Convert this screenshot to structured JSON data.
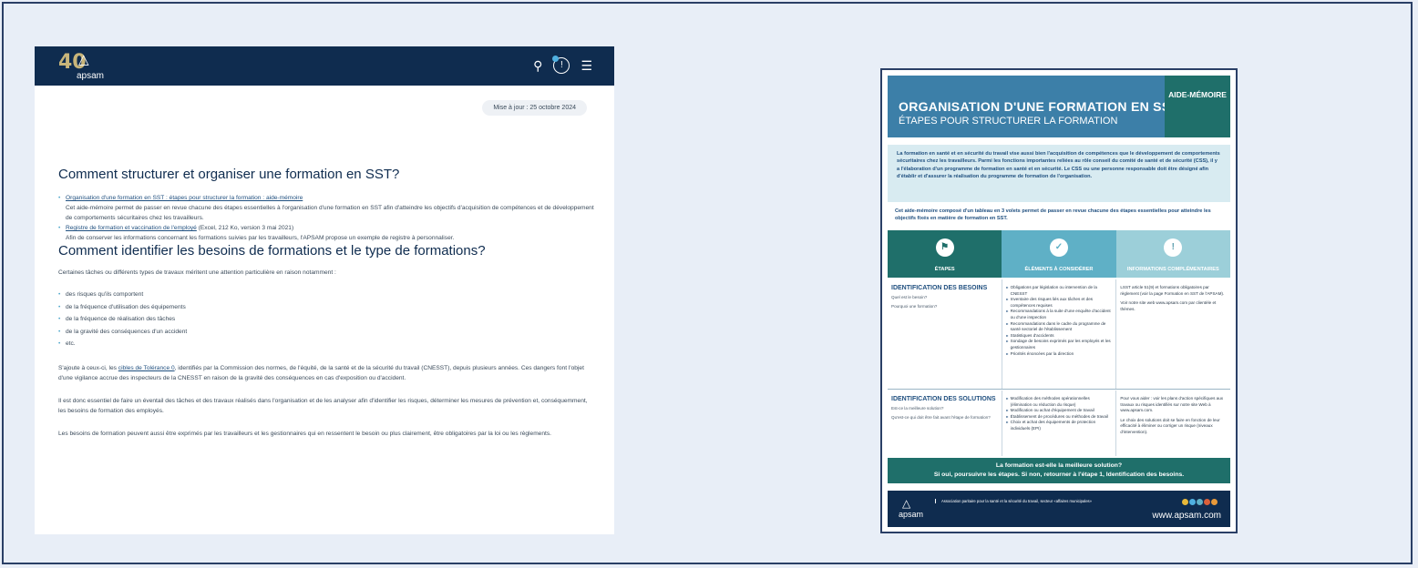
{
  "web": {
    "logo_number": "40",
    "logo_word": "apsam",
    "update": "Mise à jour : 25 octobre 2024",
    "section1_title": "Comment structurer et organiser une formation en SST?",
    "link1": "Organisation d'une formation en SST : étapes pour structurer la formation : aide-mémoire",
    "link1_desc": "Cet aide-mémoire permet de passer en revue chacune des étapes essentielles à l'organisation d'une formation en SST afin d'atteindre les objectifs d'acquisition de compétences et de développement de comportements sécuritaires chez les travailleurs.",
    "link2": "Registre de formation et vaccination de l'employé",
    "link2_meta": "(Excel, 212 Ko, version 3 mai 2021)",
    "link2_desc": "Afin de conserver les informations concernant les formations suivies par les travailleurs, l'APSAM propose un exemple de registre à personnaliser.",
    "section2_title": "Comment identifier les besoins de formations et le type de formations?",
    "para1": "Certaines tâches ou différents types de travaux méritent une attention particulière en raison notamment :",
    "bullets": [
      "des risques qu'ils comportent",
      "de la fréquence d'utilisation des équipements",
      "de la fréquence de réalisation des tâches",
      "de la gravité des conséquences d'un accident",
      "etc."
    ],
    "para2_a": "S'ajoute à ceux-ci, les",
    "para2_link": "cibles de Tolérance 0",
    "para2_b": ", identifiés par la Commission des normes, de l'équité, de la santé et de la sécurité du travail (CNESST), depuis plusieurs années. Ces dangers font l'objet d'une vigilance accrue des inspecteurs de la CNESST en raison de la gravité des conséquences en cas d'exposition ou d'accident.",
    "para3": "Il est donc essentiel de faire un éventail des tâches et des travaux réalisés dans l'organisation et de les analyser afin d'identifier les risques, déterminer les mesures de prévention et, conséquemment, les besoins de formation des employés.",
    "para4": "Les besoins de formation peuvent aussi être exprimés par les travailleurs et les gestionnaires qui en ressentent le besoin ou plus clairement, être obligatoires par la loi ou les règlements."
  },
  "doc": {
    "title": "ORGANISATION D'UNE FORMATION EN SST",
    "subtitle": "ÉTAPES POUR STRUCTURER LA FORMATION",
    "tag": "AIDE-MÉMOIRE",
    "intro": "La formation en santé et en sécurité du travail vise aussi bien l'acquisition de compétences que le développement de comportements sécuritaires chez les travailleurs. Parmi les fonctions importantes reliées au rôle conseil du comité de santé et de sécurité (CSS), il y a l'élaboration d'un programme de formation en santé et en sécurité. Le CSS ou une personne responsable doit être désigné afin d'établir et d'assurer la réalisation du programme de formation de l'organisation.",
    "intro2": "Cet aide-mémoire composé d'un tableau en 3 volets permet de passer en revue chacune des étapes essentielles pour atteindre les objectifs fixés en matière de formation en SST.",
    "col1": "ÉTAPES",
    "col2": "ÉLÉMENTS À CONSIDÉRER",
    "col3": "INFORMATIONS COMPLÉMENTAIRES",
    "s1_title": "IDENTIFICATION DES BESOINS",
    "s1_q1": "Quel est le besoin?",
    "s1_q2": "Pourquoi une formation?",
    "s1_items": [
      "Obligations par législation ou intervention de la CNESST",
      "Inventaire des risques liés aux tâches et des compétences requises",
      "Recommandations à la suite d'une enquête d'accident ou d'une inspection",
      "Recommandations dans le cadre du programme de santé sectoriel de l'établissement",
      "Statistiques d'accidents",
      "Sondage de besoins exprimés par les employés et les gestionnaires",
      "Priorités énoncées par la direction"
    ],
    "s1_info1": "LSST article 51(9) et formations obligatoires par règlement (voir la page Formation en SST de l'APSAM).",
    "s1_info2": "Voir notre site web www.apsam.com par clientèle et thèmes.",
    "s2_title": "IDENTIFICATION DES SOLUTIONS",
    "s2_q1": "Est-ce la meilleure solution?",
    "s2_q2": "Qu'est-ce qui doit être fait avant l'étape de formation?",
    "s2_items": [
      "Modification des méthodes opérationnelles (élimination ou réduction du risque)",
      "Modification ou achat d'équipement de travail",
      "Établissement de procédures ou méthodes de travail",
      "Choix et achat des équipements de protection individuels (EPI)"
    ],
    "s2_info1": "Pour vous aider : voir les plans d'action spécifiques aux travaux ou risques identifiés sur notre site Web à www.apsam.com.",
    "s2_info2": "Le choix des solutions doit se faire en fonction de leur efficacité à éliminer ou corriger un risque (niveaux d'intervention).",
    "band1": "La formation est-elle la meilleure solution?",
    "band2": "Si oui, poursuivre les étapes. Si non, retourner à l'étape 1, Identification des besoins.",
    "footer_logo": "apsam",
    "footer_org": "Association paritaire pour la santé et la sécurité du travail, secteur «affaires municipales»",
    "footer_url": "www.apsam.com"
  },
  "colors": {
    "navy": "#0f2c4f",
    "teal": "#1f6f6a",
    "sky": "#3c7fa8"
  }
}
